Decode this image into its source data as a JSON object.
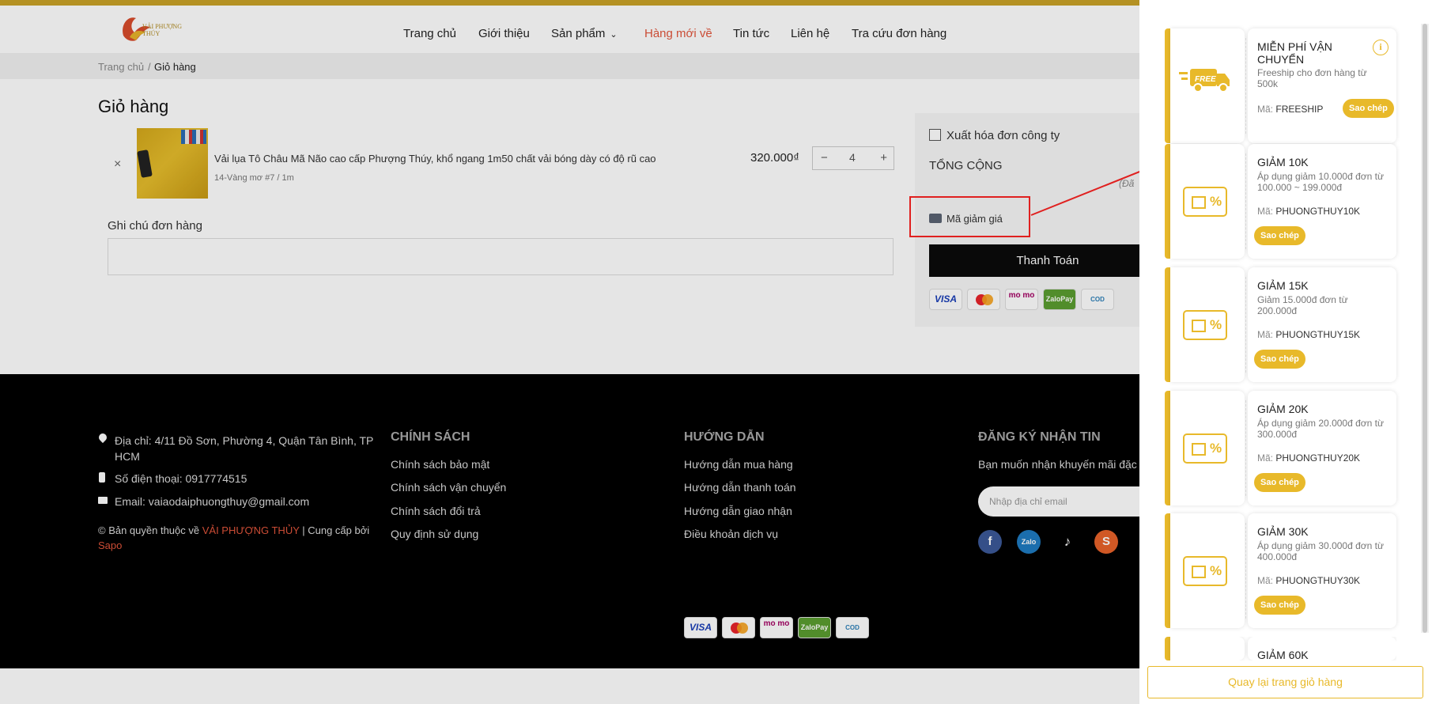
{
  "header": {
    "logo_text": "VẢI PHƯỢNG THÚY",
    "nav": [
      "Trang chủ",
      "Giới thiệu",
      "Sản phẩm",
      "Hàng mới về",
      "Tin tức",
      "Liên hệ",
      "Tra cứu đơn hàng"
    ]
  },
  "breadcrumb": {
    "home": "Trang chủ",
    "sep": "/",
    "current": "Giỏ hàng"
  },
  "cart": {
    "title": "Giỏ hàng",
    "remove": "×",
    "item": {
      "name": "Vải lụa Tô Châu Mã Não cao cấp Phượng Thúy, khổ ngang 1m50 chất vải bóng dày có độ rũ cao",
      "variant": "14-Vàng mơ #7 / 1m",
      "price": "320.000₫",
      "quantity": "4",
      "minus": "−",
      "plus": "+"
    },
    "note_label": "Ghi chú đơn hàng"
  },
  "summary": {
    "company_invoice": "Xuất hóa đơn công ty",
    "total_label": "TỔNG CỘNG",
    "vat_note": "(Đã",
    "discount_label": "Mã giảm giá",
    "pay_button": "Thanh Toán"
  },
  "payment_icons": [
    "VISA",
    "mastercard",
    "mo mo",
    "ZaloPay",
    "COD"
  ],
  "footer": {
    "address": "Địa chỉ: 4/11 Đồ Sơn, Phường 4, Quận Tân Bình, TP HCM",
    "phone": "Số điện thoại: 0917774515",
    "email": "Email: vaiaodaiphuongthuy@gmail.com",
    "copyright_prefix": "© Bản quyền thuộc về ",
    "copyright_brand": "VẢI PHƯỢNG THỦY",
    "copyright_mid": " | Cung cấp bởi",
    "copyright_provider": "Sapo",
    "policy_heading": "CHÍNH SÁCH",
    "policy_links": [
      "Chính sách bảo mật",
      "Chính sách vận chuyển",
      "Chính sách đổi trả",
      "Quy định sử dụng"
    ],
    "guide_heading": "HƯỚNG DẪN",
    "guide_links": [
      "Hướng dẫn mua hàng",
      "Hướng dẫn thanh toán",
      "Hướng dẫn giao nhận",
      "Điều khoản dịch vụ"
    ],
    "newsletter_heading": "ĐĂNG KÝ NHẬN TIN",
    "newsletter_text": "Bạn muốn nhận khuyến mãi đặc",
    "newsletter_placeholder": "Nhập địa chỉ email",
    "social": [
      "facebook-icon",
      "zalo-icon",
      "tiktok-icon",
      "shopee-icon"
    ]
  },
  "coupons": [
    {
      "title": "MIỄN PHÍ VẬN CHUYỂN",
      "desc": "Freeship cho đơn hàng từ 500k",
      "code_label": "Mã:",
      "code": "FREESHIP",
      "copy": "Sao chép",
      "icon": "free-shipping-truck-icon"
    },
    {
      "title": "GIẢM 10K",
      "desc": "Áp dụng giảm 10.000đ đơn từ 100.000 ~ 199.000đ",
      "code_label": "Mã:",
      "code": "PHUONGTHUY10K",
      "copy": "Sao chép",
      "icon": "gift-percent-icon"
    },
    {
      "title": "GIẢM 15K",
      "desc": "Giảm 15.000đ đơn từ 200.000đ",
      "code_label": "Mã:",
      "code": "PHUONGTHUY15K",
      "copy": "Sao chép",
      "icon": "gift-percent-icon"
    },
    {
      "title": "GIẢM 20K",
      "desc": "Áp dụng giảm 20.000đ đơn từ 300.000đ",
      "code_label": "Mã:",
      "code": "PHUONGTHUY20K",
      "copy": "Sao chép",
      "icon": "gift-percent-icon"
    },
    {
      "title": "GIẢM 30K",
      "desc": "Áp dụng giảm 30.000đ đơn từ 400.000đ",
      "code_label": "Mã:",
      "code": "PHUONGTHUY30K",
      "copy": "Sao chép",
      "icon": "gift-percent-icon"
    },
    {
      "title": "GIẢM 60K"
    }
  ],
  "drawer": {
    "back_button": "Quay lại trang giỏ hàng"
  },
  "colors": {
    "accent": "#e8b92a",
    "highlight": "#e0201f",
    "nav_active": "#e2553b"
  }
}
